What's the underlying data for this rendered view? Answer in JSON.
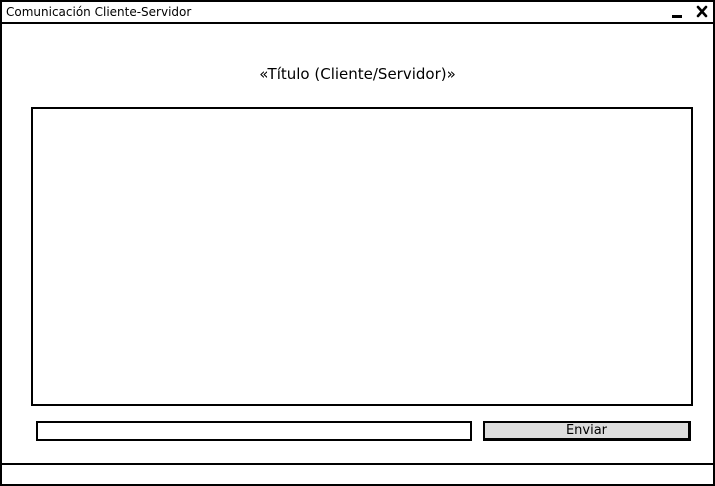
{
  "window": {
    "title": "Comunicación Cliente-Servidor",
    "minimize_icon": "minimize-icon",
    "close_icon": "close-icon"
  },
  "main": {
    "heading": "«Título (Cliente/Servidor)»",
    "messages": [],
    "input": {
      "value": "",
      "placeholder": ""
    },
    "send_label": "Enviar"
  },
  "statusbar": {
    "text": ""
  }
}
